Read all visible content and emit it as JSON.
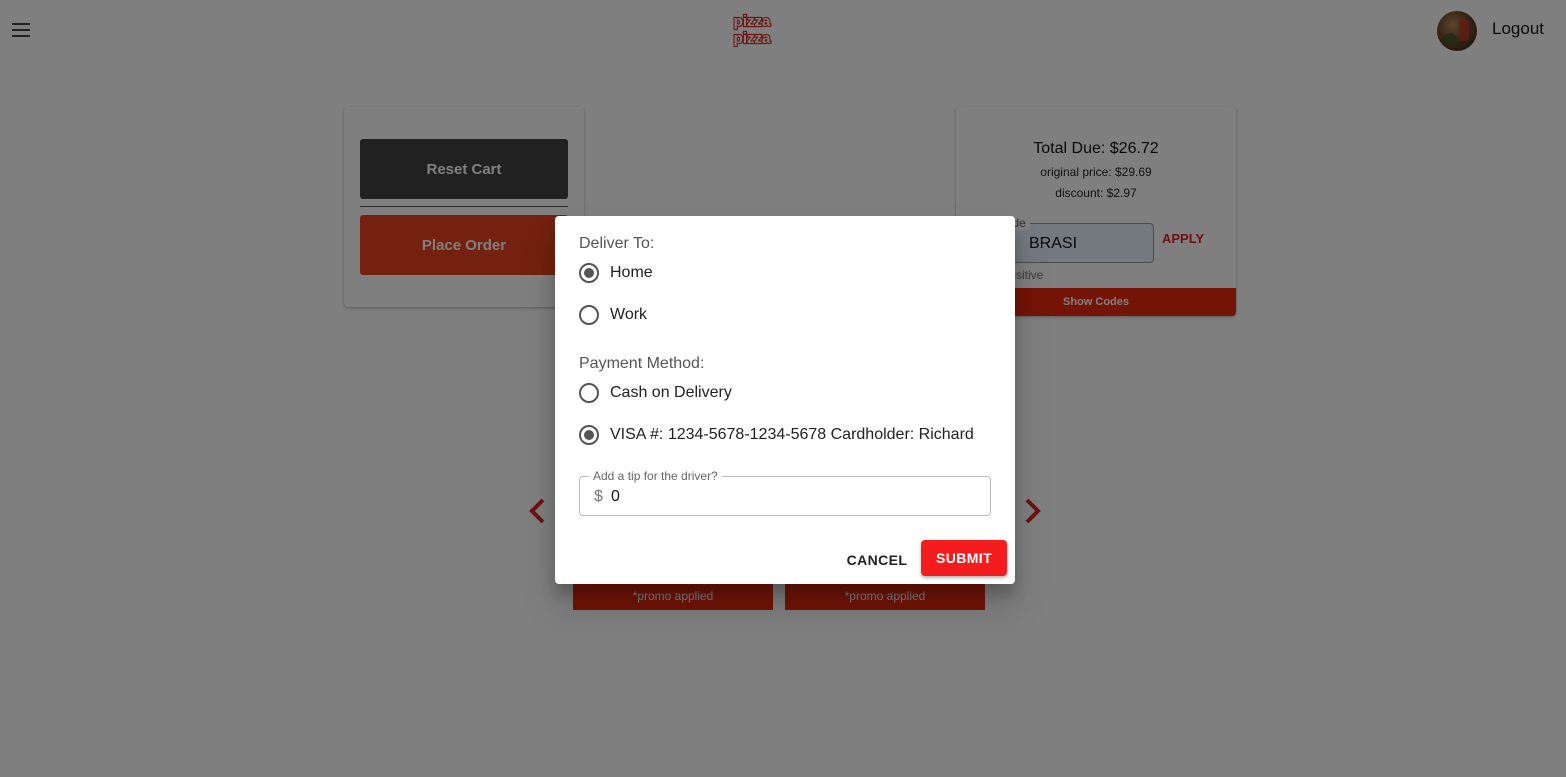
{
  "header": {
    "logo_text_top": "pizza",
    "logo_text_bottom": "pizza",
    "logout_label": "Logout"
  },
  "cart_actions": {
    "reset_label": "Reset Cart",
    "place_order_label": "Place Order"
  },
  "order_summary": {
    "total_due": "Total Due: $26.72",
    "original_price": "original price: $29.69",
    "discount": "discount: $2.97",
    "promo_label": "o Code",
    "promo_value": "BRASI",
    "promo_helper": "e-sensitive",
    "apply_label": "APPLY",
    "show_codes_label": "Show Codes"
  },
  "carousel": {
    "promo_tags": [
      "*promo applied",
      "*promo applied"
    ]
  },
  "dialog": {
    "deliver_to_label": "Deliver To:",
    "deliver_options": [
      {
        "label": "Home",
        "checked": true
      },
      {
        "label": "Work",
        "checked": false
      }
    ],
    "payment_label": "Payment Method:",
    "payment_options": [
      {
        "label": "Cash on Delivery",
        "checked": false
      },
      {
        "label": "VISA #: 1234-5678-1234-5678 Cardholder: Richard",
        "checked": true
      }
    ],
    "tip_label": "Add a tip for the driver?",
    "tip_prefix": "$",
    "tip_value": "0",
    "cancel_label": "CANCEL",
    "submit_label": "SUBMIT"
  },
  "colors": {
    "brand_red": "#f41c1c",
    "place_order": "#e8421f",
    "reset_button": "#424242",
    "backdrop": "rgba(0,0,0,0.5)"
  }
}
